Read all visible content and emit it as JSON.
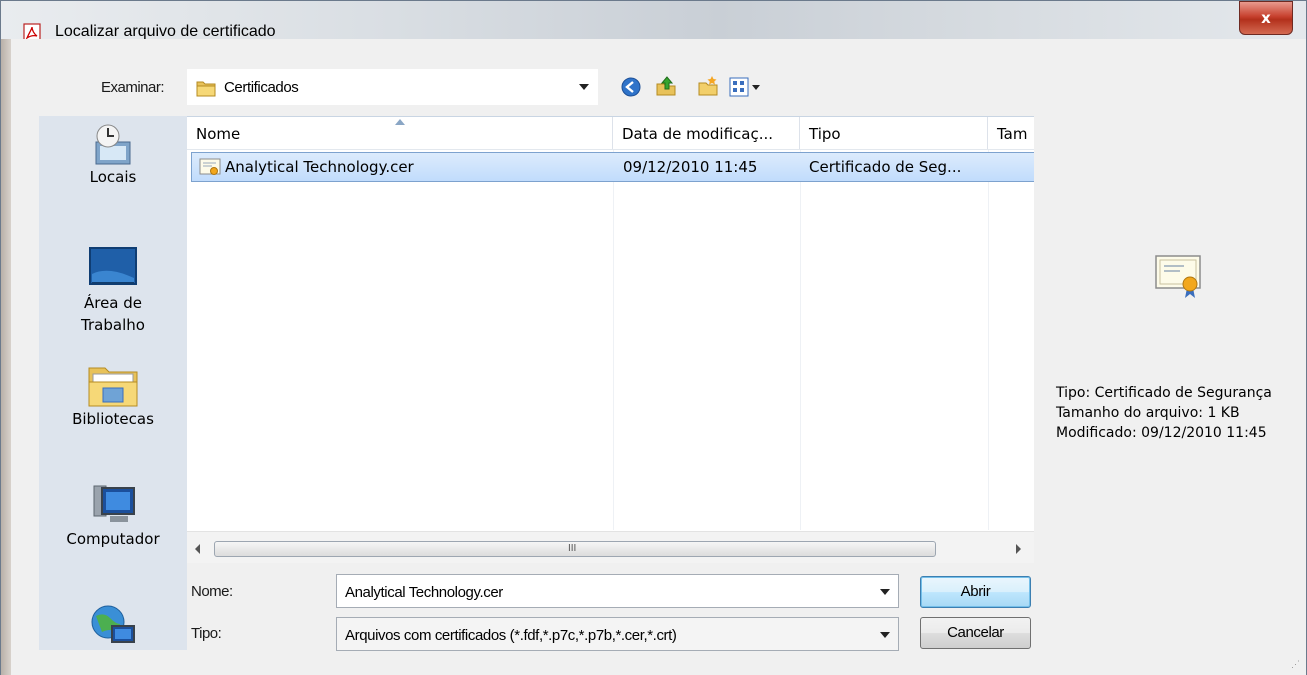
{
  "window": {
    "title": "Localizar arquivo de certificado",
    "close_label": "x"
  },
  "toolbar": {
    "lookin_label": "Examinar:",
    "lookin_value": "Certificados",
    "icons": [
      "back-icon",
      "up-folder-icon",
      "new-folder-icon",
      "view-menu-icon"
    ]
  },
  "places": [
    {
      "label": "Locais",
      "icon": "recent-places-icon"
    },
    {
      "label": "Área de Trabalho",
      "icon": "desktop-icon"
    },
    {
      "label": "Bibliotecas",
      "icon": "libraries-icon"
    },
    {
      "label": "Computador",
      "icon": "computer-icon"
    },
    {
      "label": "",
      "icon": "network-icon"
    }
  ],
  "file_list": {
    "columns": [
      "Nome",
      "Data de modificaç...",
      "Tipo",
      "Tam"
    ],
    "rows": [
      {
        "name": "Analytical Technology.cer",
        "date": "09/12/2010 11:45",
        "type": "Certificado de Seg...",
        "selected": true
      }
    ],
    "scrollbar_grip": "III"
  },
  "footer": {
    "name_label": "Nome:",
    "name_value": "Analytical Technology.cer",
    "type_label": "Tipo:",
    "type_value": "Arquivos com certificados (*.fdf,*.p7c,*.p7b,*.cer,*.crt)",
    "open_button": "Abrir",
    "cancel_button": "Cancelar"
  },
  "preview": {
    "icon": "certificate-icon",
    "type_line": "Tipo: Certificado de Segurança",
    "size_line": "Tamanho do arquivo: 1 KB",
    "modified_line": "Modificado: 09/12/2010 11:45"
  },
  "colors": {
    "selection": "#c1dcfc",
    "places_bg": "#dde4ed",
    "dialog_bg": "#f0f0f0"
  }
}
